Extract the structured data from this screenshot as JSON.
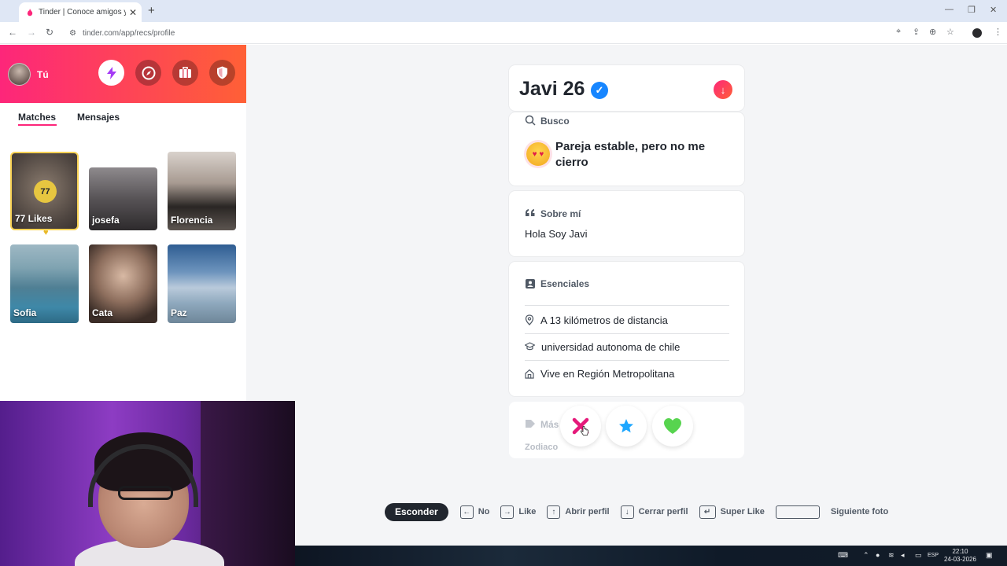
{
  "browser": {
    "tab_title": "Tinder | Conoce amigos y gente",
    "url": "tinder.com/app/recs/profile"
  },
  "sidebar": {
    "user_label": "Tú",
    "tabs": [
      "Matches",
      "Mensajes"
    ],
    "likes_count": "77",
    "likes_label": "77 Likes",
    "matches": [
      {
        "name": "josefa",
        "color": "#5d5a5c"
      },
      {
        "name": "Florencia",
        "color": "#8d7f78"
      },
      {
        "name": "Sofia",
        "color": "#4f7f94"
      },
      {
        "name": "Cata",
        "color": "#6e5648"
      },
      {
        "name": "Paz",
        "color": "#4b6b90"
      }
    ]
  },
  "profile": {
    "name": "Javi 26",
    "verified": true,
    "looking_label": "Busco",
    "looking_value": "Pareja estable, pero no me cierro",
    "about_label": "Sobre mí",
    "about_text": "Hola Soy Javi",
    "essentials_label": "Esenciales",
    "essentials": [
      {
        "icon": "location-pin-icon",
        "text": "A 13 kilómetros de distancia"
      },
      {
        "icon": "graduation-cap-icon",
        "text": "universidad autonoma de chile"
      },
      {
        "icon": "home-icon",
        "text": "Vive en Región Metropolitana"
      }
    ],
    "more_label": "Más",
    "zodiac_label": "Zodiaco"
  },
  "hints": {
    "hide": "Esconder",
    "no": "No",
    "like": "Like",
    "open_profile": "Abrir perfil",
    "close_profile": "Cerrar perfil",
    "super_like": "Super Like",
    "next_photo": "Siguiente foto"
  },
  "taskbar": {
    "lang": "ESP",
    "time": "22:10",
    "date": "24-03-2026"
  },
  "colors": {
    "brand_gradient_start": "#fd267a",
    "brand_gradient_end": "#ff6036",
    "verified_blue": "#1786ff",
    "like_green": "#57d44f",
    "superlike_blue": "#1ea7ff"
  }
}
